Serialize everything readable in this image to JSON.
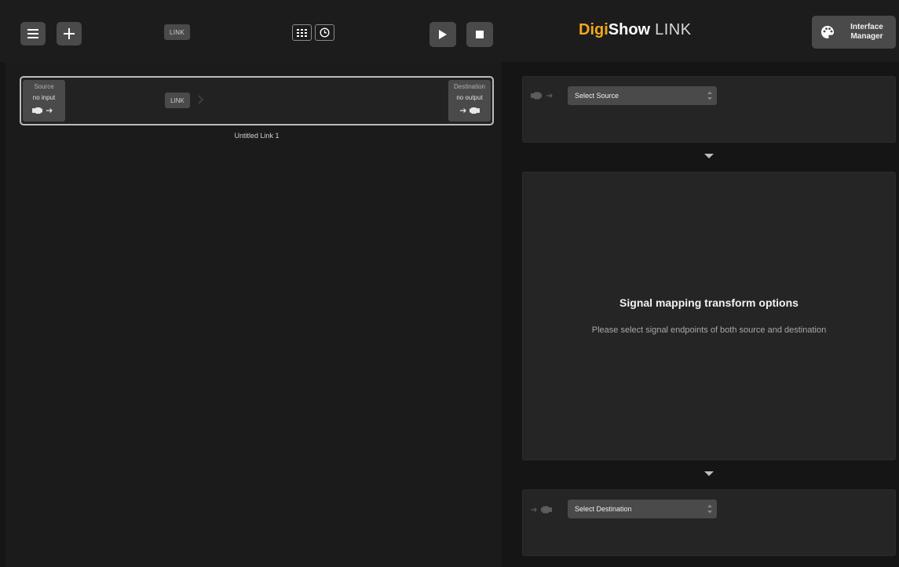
{
  "toolbar": {
    "icons": {
      "menu": "hamburger-icon",
      "add": "plus-icon",
      "grid": "grid-icon",
      "clock": "clock-icon",
      "play": "play-icon",
      "stop": "stop-icon",
      "palette": "palette-icon"
    },
    "link_label": "LINK",
    "brand": {
      "digi": "Digi",
      "show": "Show",
      "link": "LINK",
      "accent_color": "#f0a81a"
    },
    "interface_manager_line1": "Interface",
    "interface_manager_line2": "Manager"
  },
  "links": [
    {
      "name": "Untitled Link 1",
      "source_title": "Source",
      "source_status": "no input",
      "link_label": "LINK",
      "destination_title": "Destination",
      "destination_status": "no output"
    }
  ],
  "source_panel": {
    "select_value": "Select Source"
  },
  "mapping_panel": {
    "title": "Signal mapping transform options",
    "subtitle": "Please select signal endpoints of both source and destination"
  },
  "destination_panel": {
    "select_value": "Select Destination"
  }
}
